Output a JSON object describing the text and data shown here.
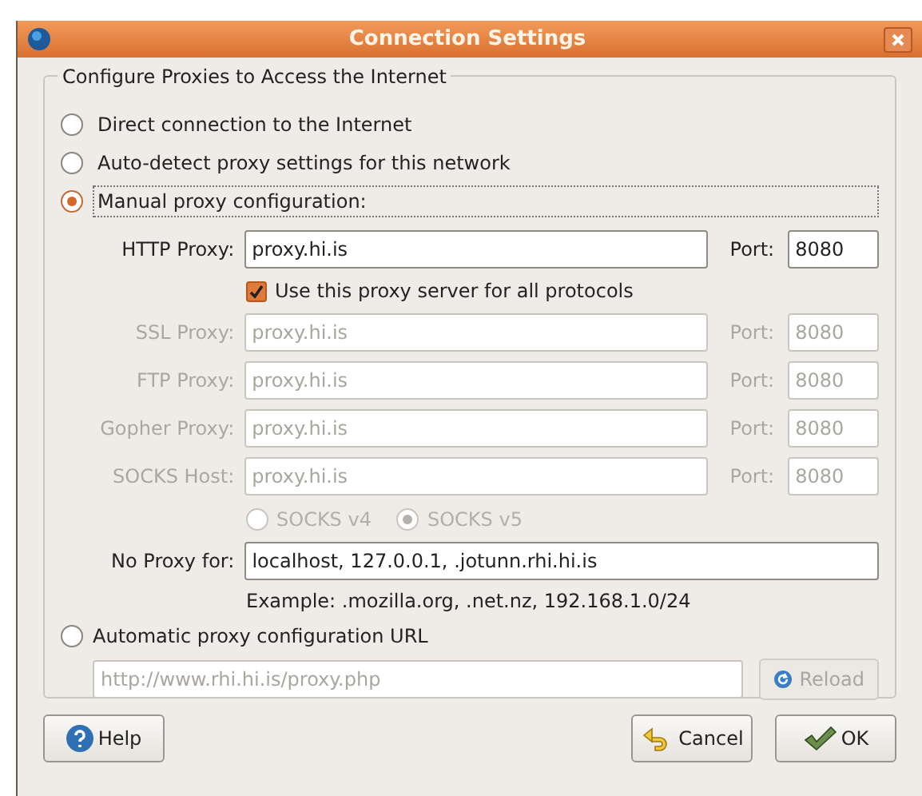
{
  "window": {
    "title": "Connection Settings"
  },
  "group_title": "Configure Proxies to Access the Internet",
  "modes": [
    {
      "label": "Direct connection to the Internet",
      "selected": false,
      "focused": false
    },
    {
      "label": "Auto-detect proxy settings for this network",
      "selected": false,
      "focused": false
    },
    {
      "label": "Manual proxy configuration:",
      "selected": true,
      "focused": true
    }
  ],
  "proxies": [
    {
      "label": "HTTP Proxy:",
      "value": "proxy.hi.is",
      "port_label": "Port:",
      "port": "8080",
      "disabled": false
    },
    {
      "label": "SSL Proxy:",
      "value": "proxy.hi.is",
      "port_label": "Port:",
      "port": "8080",
      "disabled": true
    },
    {
      "label": "FTP Proxy:",
      "value": "proxy.hi.is",
      "port_label": "Port:",
      "port": "8080",
      "disabled": true
    },
    {
      "label": "Gopher Proxy:",
      "value": "proxy.hi.is",
      "port_label": "Port:",
      "port": "8080",
      "disabled": true
    },
    {
      "label": "SOCKS Host:",
      "value": "proxy.hi.is",
      "port_label": "Port:",
      "port": "8080",
      "disabled": true
    }
  ],
  "share_all": {
    "label": "Use this proxy server for all protocols",
    "checked": true
  },
  "socks_versions": [
    {
      "label": "SOCKS v4",
      "selected": false
    },
    {
      "label": "SOCKS v5",
      "selected": true
    }
  ],
  "socks_disabled": true,
  "no_proxy": {
    "label": "No Proxy for:",
    "value": "localhost, 127.0.0.1, .jotunn.rhi.hi.is"
  },
  "example": "Example: .mozilla.org, .net.nz, 192.168.1.0/24",
  "auto_url": {
    "label": "Automatic proxy configuration URL",
    "selected": false,
    "value": "http://www.rhi.hi.is/proxy.php",
    "disabled": true
  },
  "reload_button": {
    "label": "Reload",
    "disabled": true
  },
  "buttons": [
    {
      "kind": "help",
      "label": "Help"
    },
    {
      "kind": "cancel",
      "label": "Cancel"
    },
    {
      "kind": "ok",
      "label": "OK"
    }
  ]
}
